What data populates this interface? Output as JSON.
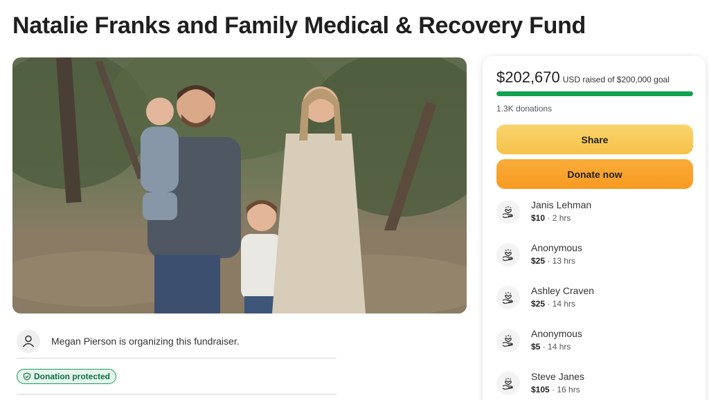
{
  "page": {
    "title": "Natalie Franks and Family Medical & Recovery Fund"
  },
  "hero": {
    "image_name": "family-photo",
    "description": "Family portrait in a wooded park"
  },
  "organizer": {
    "icon": "person-icon",
    "text": "Megan Pierson is organizing this fundraiser."
  },
  "badge": {
    "icon": "shield-icon",
    "label": "Donation protected",
    "color": "#1a9b59"
  },
  "summary": {
    "raised": "$202,670",
    "raised_suffix": "USD raised of $200,000 goal",
    "progress_fraction": 1.0,
    "progress_color": "#12a151",
    "donations": "1.3K donations"
  },
  "buttons": {
    "share": "Share",
    "donate": "Donate now",
    "share_color": "#f6c24a",
    "donate_color": "#f89a20"
  },
  "donations": [
    {
      "name": "Janis Lehman",
      "amount": "$10",
      "time": " · 2 hrs",
      "icon": "heart-hand-icon"
    },
    {
      "name": "Anonymous",
      "amount": "$25",
      "time": " · 13 hrs",
      "icon": "heart-hand-icon"
    },
    {
      "name": "Ashley Craven",
      "amount": "$25",
      "time": " · 14 hrs",
      "icon": "heart-hand-icon"
    },
    {
      "name": "Anonymous",
      "amount": "$5",
      "time": " · 14 hrs",
      "icon": "heart-hand-icon"
    },
    {
      "name": "Steve Janes",
      "amount": "$105",
      "time": " · 16 hrs",
      "icon": "heart-hand-icon"
    }
  ]
}
